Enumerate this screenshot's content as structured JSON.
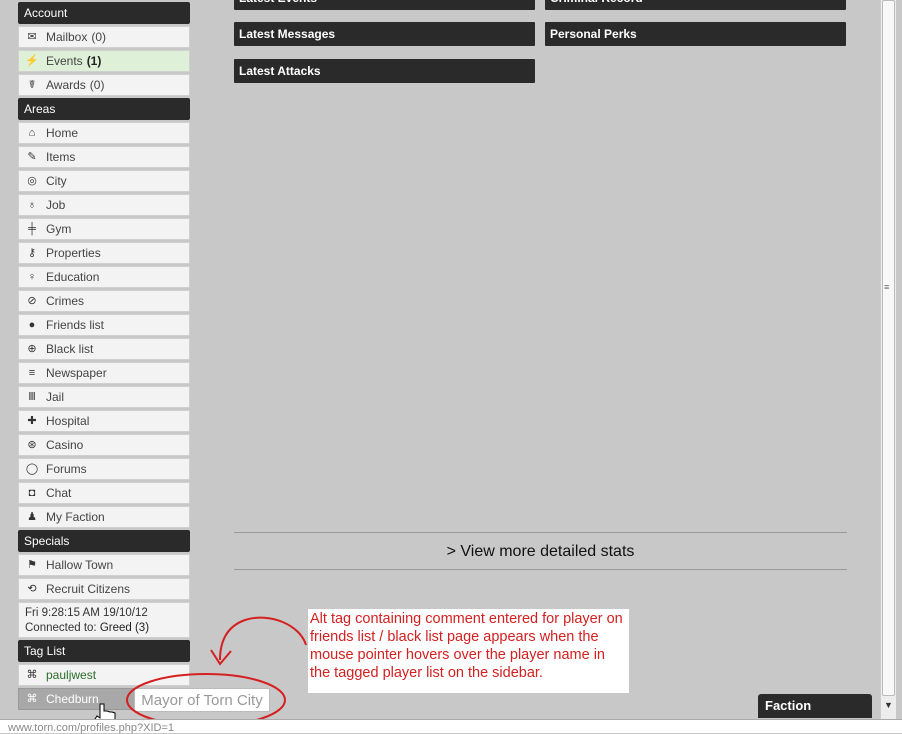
{
  "sidebar": {
    "account": {
      "header": "Account",
      "items": [
        {
          "label": "Mailbox",
          "count": "(0)",
          "icon": "envelope-icon"
        },
        {
          "label": "Events",
          "count": "(1)",
          "icon": "lightning-icon"
        },
        {
          "label": "Awards",
          "count": "(0)",
          "icon": "medal-icon"
        }
      ]
    },
    "areas": {
      "header": "Areas",
      "items": [
        {
          "label": "Home",
          "icon": "home-icon"
        },
        {
          "label": "Items",
          "icon": "pencil-icon"
        },
        {
          "label": "City",
          "icon": "globe-icon"
        },
        {
          "label": "Job",
          "icon": "money-bag-icon"
        },
        {
          "label": "Gym",
          "icon": "dumbbell-icon"
        },
        {
          "label": "Properties",
          "icon": "key-icon"
        },
        {
          "label": "Education",
          "icon": "bulb-icon"
        },
        {
          "label": "Crimes",
          "icon": "no-entry-icon"
        },
        {
          "label": "Friends list",
          "icon": "person-icon"
        },
        {
          "label": "Black list",
          "icon": "crosshair-icon"
        },
        {
          "label": "Newspaper",
          "icon": "lines-icon"
        },
        {
          "label": "Jail",
          "icon": "bars-icon"
        },
        {
          "label": "Hospital",
          "icon": "plus-icon"
        },
        {
          "label": "Casino",
          "icon": "coin-icon"
        },
        {
          "label": "Forums",
          "icon": "speech-bubble-icon"
        },
        {
          "label": "Chat",
          "icon": "chat-icon"
        },
        {
          "label": "My Faction",
          "icon": "people-icon"
        }
      ]
    },
    "specials": {
      "header": "Specials",
      "items": [
        {
          "label": "Hallow Town",
          "icon": "flag-icon"
        },
        {
          "label": "Recruit Citizens",
          "icon": "refresh-icon"
        }
      ]
    },
    "clock": {
      "time": "Fri 9:28:15 AM 19/10/12",
      "connected_label": "Connected to:",
      "server": "Greed (3)"
    },
    "tag_list": {
      "header": "Tag List",
      "items": [
        {
          "label": "pauljwest",
          "icon": "tag-icon"
        },
        {
          "label": "Chedburn",
          "icon": "tag-icon"
        }
      ]
    }
  },
  "main": {
    "bars": {
      "latest_events": "Latest Events",
      "criminal_record": "Criminal Record",
      "latest_messages": "Latest Messages",
      "personal_perks": "Personal Perks",
      "latest_attacks": "Latest Attacks"
    },
    "stats_link": "> View more detailed stats"
  },
  "annotation": "Alt tag containing comment entered for player on friends list / black list page appears when the mouse pointer hovers over the player name in the tagged player list on the sidebar.",
  "tooltip": "Mayor of Torn City",
  "faction_tab": "Faction",
  "statusbar": "www.torn.com/profiles.php?XID=1",
  "colors": {
    "header_bg": "#2a2a2a",
    "page_bg": "#c8c8c8",
    "active_item_bg": "#dff0d8",
    "annotation_red": "#d42020",
    "tag_green": "#2a6e2a"
  }
}
